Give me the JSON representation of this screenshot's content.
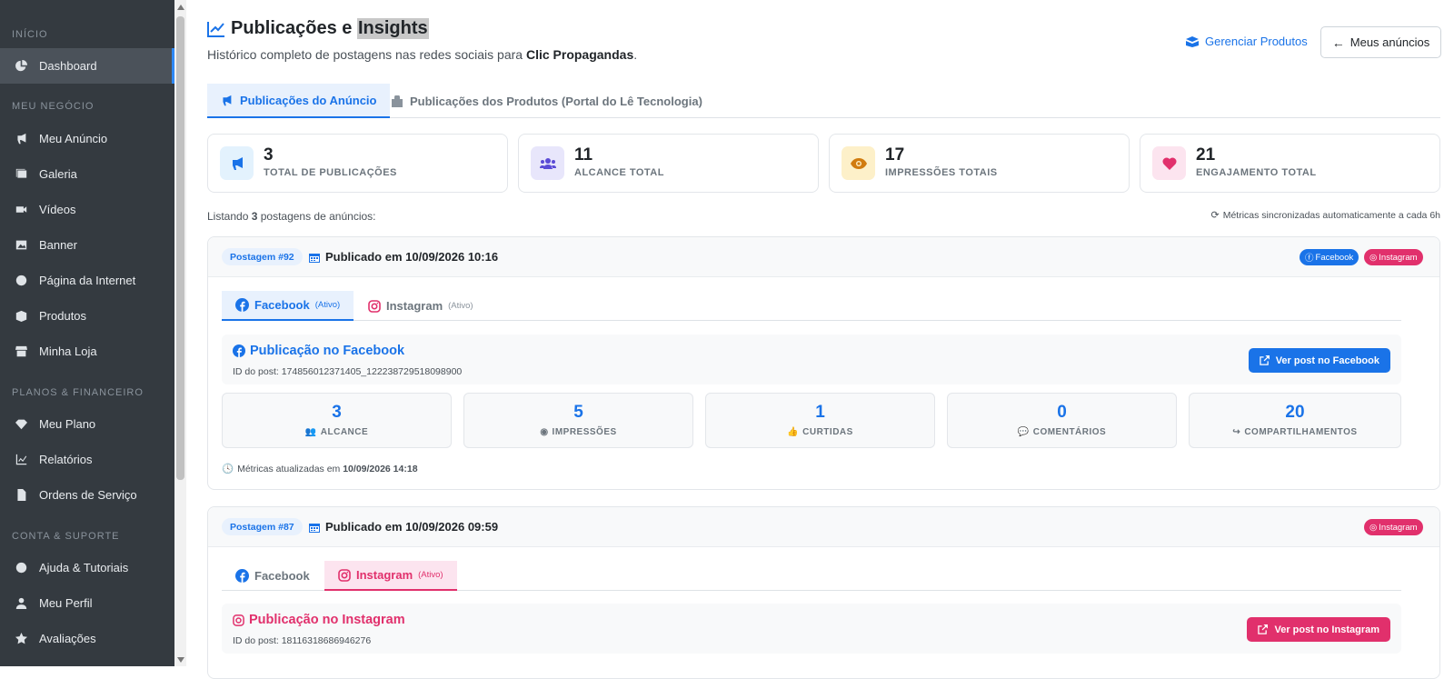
{
  "sidebar": {
    "sections": [
      "INÍCIO",
      "MEU NEGÓCIO",
      "PLANOS & FINANCEIRO",
      "CONTA & SUPORTE"
    ],
    "items": [
      {
        "label": "Dashboard",
        "icon": "chart-pie-icon"
      },
      {
        "label": "Meu Anúncio",
        "icon": "megaphone-icon"
      },
      {
        "label": "Galeria",
        "icon": "images-icon"
      },
      {
        "label": "Vídeos",
        "icon": "video-icon"
      },
      {
        "label": "Banner",
        "icon": "image-icon"
      },
      {
        "label": "Página da Internet",
        "icon": "globe-icon"
      },
      {
        "label": "Produtos",
        "icon": "box-open-icon"
      },
      {
        "label": "Minha Loja",
        "icon": "store-icon"
      },
      {
        "label": "Meu Plano",
        "icon": "gem-icon"
      },
      {
        "label": "Relatórios",
        "icon": "chart-line-icon"
      },
      {
        "label": "Ordens de Serviço",
        "icon": "file-icon"
      },
      {
        "label": "Ajuda & Tutoriais",
        "icon": "question-circle-icon"
      },
      {
        "label": "Meu Perfil",
        "icon": "user-icon"
      },
      {
        "label": "Avaliações",
        "icon": "star-icon"
      }
    ]
  },
  "header": {
    "title_a": "Publicações e ",
    "title_b": "Insights",
    "subtitle_a": "Histórico completo de postagens nas redes sociais para ",
    "subtitle_company": "Clic Propagandas",
    "subtitle_end": ".",
    "manage_products": "Gerenciar Produtos",
    "my_ads": "Meus anúncios"
  },
  "tabs": [
    "Publicações do Anúncio",
    "Publicações dos Produtos (Portal do Lê Tecnologia)"
  ],
  "stats": [
    {
      "value": "3",
      "label": "TOTAL DE PUBLICAÇÕES",
      "icon": "megaphone-icon",
      "bg": "#e3f2fd",
      "color": "#1a73e8"
    },
    {
      "value": "11",
      "label": "ALCANCE TOTAL",
      "icon": "users-icon",
      "bg": "#e8e6fb",
      "color": "#5b4bd6"
    },
    {
      "value": "17",
      "label": "IMPRESSÕES TOTAIS",
      "icon": "eye-icon",
      "bg": "#fdf0c9",
      "color": "#d17b0f"
    },
    {
      "value": "21",
      "label": "ENGAJAMENTO TOTAL",
      "icon": "heart-icon",
      "bg": "#fce4ef",
      "color": "#e1306c"
    }
  ],
  "listing": {
    "prefix": "Listando ",
    "count": "3",
    "suffix": " postagens de anúncios:"
  },
  "sync_text": "Métricas sincronizadas automaticamente a cada 6h",
  "posts": [
    {
      "id": "Postagem #92",
      "published_prefix": "Publicado em ",
      "published_at": "10/09/2026 10:16",
      "badges": [
        "Facebook",
        "Instagram"
      ],
      "tabs": [
        {
          "label": "Facebook",
          "status": "(Ativo)"
        },
        {
          "label": "Instagram",
          "status": "(Ativo)"
        }
      ],
      "panel_title": "Publicação no Facebook",
      "post_id_label": "ID do post: ",
      "post_id": "174856012371405_122238729518098900",
      "view_button": "Ver post no Facebook",
      "metrics": [
        {
          "value": "3",
          "label": "ALCANCE"
        },
        {
          "value": "5",
          "label": "IMPRESSÕES"
        },
        {
          "value": "1",
          "label": "CURTIDAS"
        },
        {
          "value": "0",
          "label": "COMENTÁRIOS"
        },
        {
          "value": "20",
          "label": "COMPARTILHAMENTOS"
        }
      ],
      "updated_prefix": "Métricas atualizadas em ",
      "updated_at": "10/09/2026 14:18"
    },
    {
      "id": "Postagem #87",
      "published_prefix": "Publicado em ",
      "published_at": "10/09/2026 09:59",
      "badges": [
        "Instagram"
      ],
      "tabs": [
        {
          "label": "Facebook"
        },
        {
          "label": "Instagram",
          "status": "(Ativo)"
        }
      ],
      "panel_title": "Publicação no Instagram",
      "post_id_label": "ID do post: ",
      "post_id": "18116318686946276",
      "view_button": "Ver post no Instagram"
    }
  ],
  "colors": {
    "sidebar": "#343a40",
    "accent": "#1a73e8",
    "instagram": "#e1306c"
  }
}
